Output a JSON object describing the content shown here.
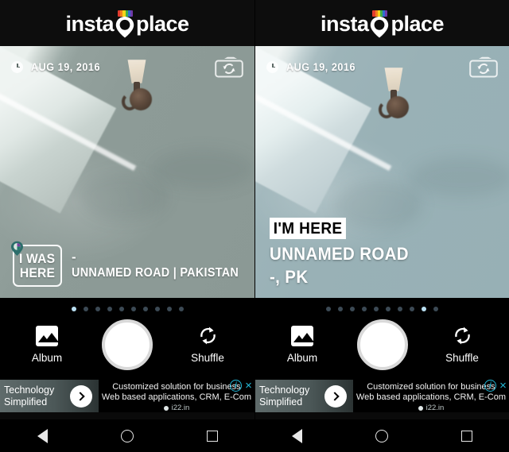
{
  "app": {
    "logo_part1": "insta",
    "logo_part2": "place",
    "logo_pin_icon": "location-pin-icon",
    "rainbow_colors": [
      "#e23c2e",
      "#f07f1e",
      "#f5d61a",
      "#3fae49",
      "#2f6fd0",
      "#6f39a8"
    ]
  },
  "photo": {
    "clock_icon": "clock-icon",
    "date": "AUG 19, 2016",
    "camera_switch_icon": "camera-switch-icon",
    "subject": "wall-sconce-lamp"
  },
  "overlay_left": {
    "badge_line1": "I WAS",
    "badge_line2": "HERE",
    "badge_pin_icon": "location-pin-icon",
    "dash": "-",
    "place": "UNNAMED ROAD | PAKISTAN"
  },
  "overlay_right": {
    "tag": "I'M HERE",
    "line1": "UNNAMED ROAD",
    "line2": "-, PK"
  },
  "controls": {
    "dots_count": 10,
    "active_dot_left": 0,
    "active_dot_right": 8,
    "album_label": "Album",
    "album_icon": "image-icon",
    "shutter_icon": "shutter-button",
    "shuffle_label": "Shuffle",
    "shuffle_icon": "refresh-cycle-icon"
  },
  "ad": {
    "brand_line1": "Technology",
    "brand_line2": "Simplified",
    "arrow_icon": "chevron-right-icon",
    "headline1": "Customized solution for business",
    "headline2": "Web based applications, CRM, E-Com",
    "url": "i22.in",
    "info_icon": "info-icon",
    "info_glyph": "i",
    "close_icon": "close-icon",
    "close_glyph": "×"
  },
  "navbar": {
    "back_icon": "back-triangle-icon",
    "home_icon": "home-circle-icon",
    "recents_icon": "recents-square-icon"
  },
  "colors": {
    "accent_cyan": "#23b7d6",
    "dot_active": "#b9dff2",
    "dot_inactive": "#3c4a55"
  }
}
